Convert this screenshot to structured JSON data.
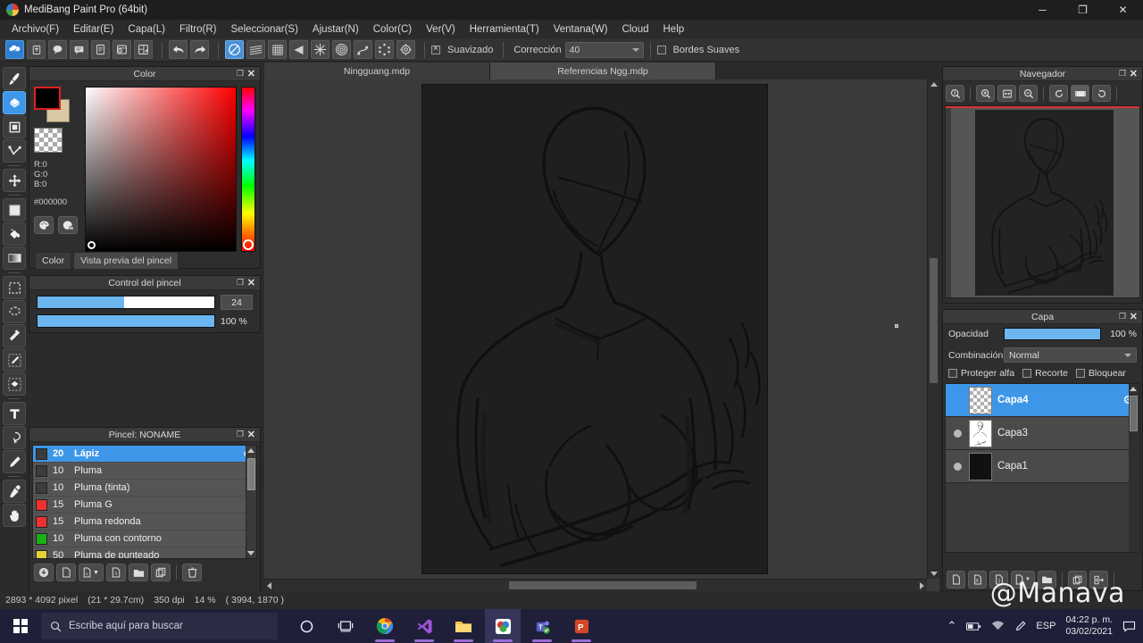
{
  "window": {
    "title": "MediBang Paint Pro (64bit)",
    "minimize": "─",
    "maximize": "❐",
    "close": "✕"
  },
  "menubar": {
    "items": [
      "Archivo(F)",
      "Editar(E)",
      "Capa(L)",
      "Filtro(R)",
      "Seleccionar(S)",
      "Ajustar(N)",
      "Color(C)",
      "Ver(V)",
      "Herramienta(T)",
      "Ventana(W)",
      "Cloud",
      "Help"
    ]
  },
  "toolbar": {
    "cloud_buttons": [
      {
        "name": "cloud-save-icon"
      },
      {
        "name": "cloud-upload-icon"
      },
      {
        "name": "comment-icon"
      },
      {
        "name": "chat-icon"
      },
      {
        "name": "document-icon"
      },
      {
        "name": "history-icon"
      },
      {
        "name": "new-comic-icon"
      }
    ],
    "undo": "↶",
    "redo": "↷",
    "ruler_buttons": [
      "no-ruler-icon",
      "parallel-ruler-icon",
      "grid-ruler-icon",
      "vanishing-point-icon",
      "radial-ruler-icon",
      "concentric-ruler-icon",
      "curve-ruler-icon",
      "polygon-ruler-icon",
      "ruler-settings-icon"
    ],
    "smoothing_label": "Suavizado",
    "correction_label": "Corrección",
    "correction_value": "40",
    "soft_edges_label": "Bordes Suaves"
  },
  "tools": {
    "items": [
      {
        "name": "brush-tool",
        "selected": false
      },
      {
        "name": "eraser-tool",
        "selected": true
      },
      {
        "name": "shape-tool",
        "selected": false
      },
      {
        "name": "bezier-tool",
        "selected": false
      },
      {
        "name": "move-tool",
        "selected": false
      },
      {
        "name": "fill-tool",
        "selected": false
      },
      {
        "name": "bucket-tool",
        "selected": false
      },
      {
        "name": "gradient-tool",
        "selected": false
      },
      {
        "name": "rect-select-tool",
        "selected": false
      },
      {
        "name": "lasso-select-tool",
        "selected": false
      },
      {
        "name": "magic-wand-tool",
        "selected": false
      },
      {
        "name": "select-pen-tool",
        "selected": false
      },
      {
        "name": "select-eraser-tool",
        "selected": false
      },
      {
        "name": "text-tool",
        "selected": false
      },
      {
        "name": "operation-tool",
        "selected": false
      },
      {
        "name": "pen-tool",
        "selected": false
      },
      {
        "name": "eyedropper-tool",
        "selected": false
      },
      {
        "name": "hand-tool",
        "selected": false
      }
    ]
  },
  "color_panel": {
    "title": "Color",
    "r_label": "R:0",
    "g_label": "G:0",
    "b_label": "B:0",
    "hex": "#000000",
    "foreground": "#000000",
    "background": "#d9c9a3",
    "tabs": [
      {
        "label": "Color",
        "active": true
      },
      {
        "label": "Vista previa del pincel",
        "active": false
      }
    ]
  },
  "brush_control": {
    "title": "Control del pincel",
    "size_value": "24",
    "size_percent": 49,
    "opacity_value": "100 %",
    "opacity_percent": 100
  },
  "brush_panel": {
    "title": "Pincel: NONAME",
    "brushes": [
      {
        "size": "20",
        "name": "Lápiz",
        "color": "#3c3c3c",
        "selected": true
      },
      {
        "size": "10",
        "name": "Pluma",
        "color": "#3c3c3c",
        "selected": false
      },
      {
        "size": "10",
        "name": "Pluma (tinta)",
        "color": "#3c3c3c",
        "selected": false
      },
      {
        "size": "15",
        "name": "Pluma G",
        "color": "#f03030",
        "selected": false
      },
      {
        "size": "15",
        "name": "Pluma redonda",
        "color": "#f03030",
        "selected": false
      },
      {
        "size": "10",
        "name": "Pluma con contorno",
        "color": "#19b219",
        "selected": false
      },
      {
        "size": "50",
        "name": "Pluma de punteado",
        "color": "#e8d23a",
        "selected": false
      }
    ],
    "tools": [
      "add-brush-icon",
      "new-brush-icon",
      "duplicate-brush-icon",
      "script-brush-icon",
      "folder-icon",
      "copy-icon",
      "delete-icon"
    ]
  },
  "canvas": {
    "tabs": [
      {
        "label": "Ningguang.mdp",
        "active": true
      },
      {
        "label": "Referencias Ngg.mdp",
        "active": false
      }
    ]
  },
  "navigator": {
    "title": "Navegador",
    "buttons": [
      "zoom-reset-icon",
      "zoom-in-icon",
      "fit-screen-icon",
      "zoom-out-icon",
      "rotate-left-icon",
      "reset-rotation-icon",
      "rotate-right-icon"
    ]
  },
  "layer_panel": {
    "title": "Capa",
    "opacity_label": "Opacidad",
    "opacity_value": "100 %",
    "opacity_percent": 100,
    "blend_label": "Combinación",
    "blend_value": "Normal",
    "checks": [
      {
        "label": "Proteger alfa",
        "checked": false
      },
      {
        "label": "Recorte",
        "checked": false
      },
      {
        "label": "Bloquear",
        "checked": false
      }
    ],
    "layers": [
      {
        "name": "Capa4",
        "selected": true,
        "visible": false,
        "thumb": "transparent"
      },
      {
        "name": "Capa3",
        "selected": false,
        "visible": true,
        "thumb": "sketch"
      },
      {
        "name": "Capa1",
        "selected": false,
        "visible": true,
        "thumb": "dark"
      }
    ],
    "tools": [
      "new-layer-icon",
      "new-8bit-layer-icon",
      "new-1bit-layer-icon",
      "add-layer-menu-icon",
      "folder-icon",
      "duplicate-layer-icon",
      "merge-layer-icon"
    ]
  },
  "statusbar": {
    "dimensions": "2893 * 4092 pixel",
    "physical": "(21 * 29.7cm)",
    "dpi": "350 dpi",
    "zoom": "14 %",
    "coords": "( 3994, 1870 )"
  },
  "watermark": "@Manava",
  "taskbar": {
    "search_placeholder": "Escribe aquí para buscar",
    "icons": [
      {
        "name": "cortana-icon"
      },
      {
        "name": "task-view-icon"
      },
      {
        "name": "chrome-icon"
      },
      {
        "name": "vscode-icon"
      },
      {
        "name": "file-explorer-icon"
      },
      {
        "name": "medibang-icon"
      },
      {
        "name": "teams-icon"
      },
      {
        "name": "powerpoint-icon"
      }
    ],
    "tray": {
      "chevron": "⌃",
      "battery": "battery-icon",
      "wifi": "wifi-icon",
      "pen": "pen-icon",
      "language": "ESP",
      "time": "04:22 p. m.",
      "date": "03/02/2021",
      "notification": "notification-icon"
    }
  }
}
